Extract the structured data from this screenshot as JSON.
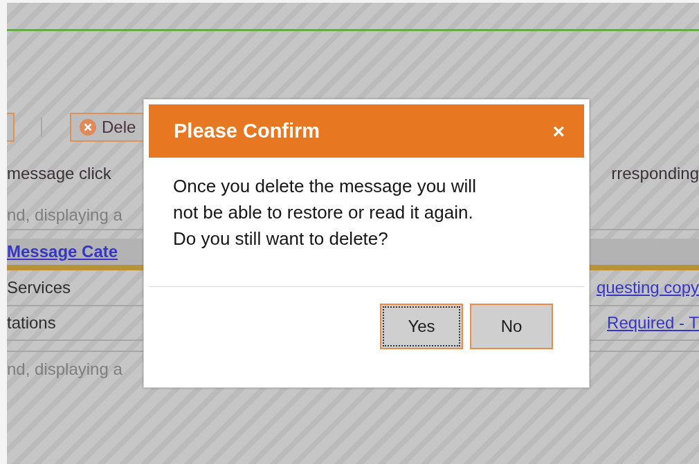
{
  "toolbar": {
    "delete_button": {
      "label": "Dele"
    }
  },
  "instructions": {
    "left": "message click",
    "right": "rresponding"
  },
  "count_top": "nd, displaying a",
  "table": {
    "columns": [
      {
        "label": "Message Cate"
      }
    ],
    "rows": [
      {
        "column_1": "Services",
        "column_2": "questing copy"
      },
      {
        "column_1": "tations",
        "column_2": "Required - T"
      }
    ]
  },
  "count_bottom": "nd, displaying a",
  "dialog": {
    "title": "Please Confirm",
    "close": "×",
    "message": "Once you delete the message you will not be able to restore or read it again. Do you still want to delete?",
    "buttons": [
      {
        "label": "Yes",
        "focused": true
      },
      {
        "label": "No",
        "focused": false
      }
    ]
  }
}
